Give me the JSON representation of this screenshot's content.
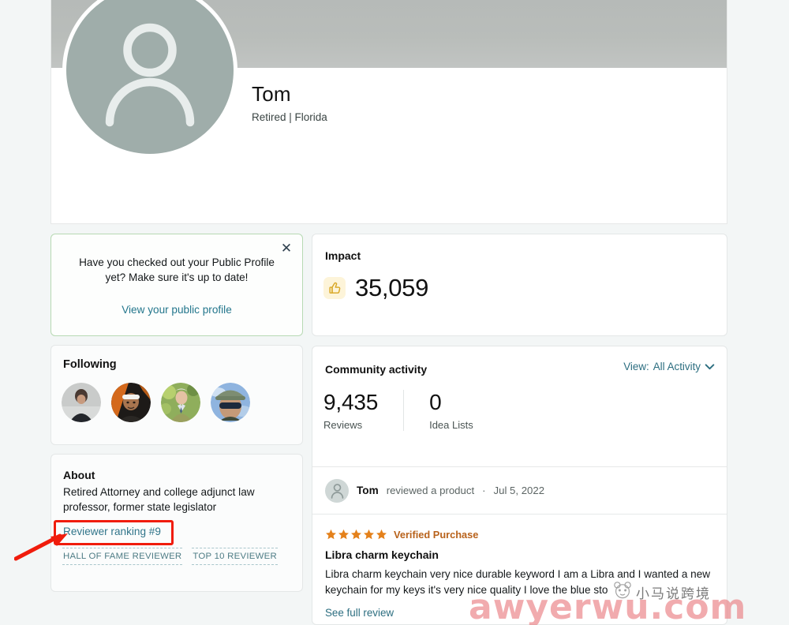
{
  "profile": {
    "name": "Tom",
    "subtitle": "Retired | Florida",
    "avatar_icon": "person-avatar-icon"
  },
  "public_profile_promo": {
    "message": "Have you checked out your Public Profile yet? Make sure it's up to date!",
    "link_label": "View your public profile",
    "close_icon": "close-icon",
    "border_color": "#b7d9b3"
  },
  "following": {
    "title": "Following",
    "avatars": [
      {
        "name": "following-avatar-1",
        "alt": "person in dark suit on gray background"
      },
      {
        "name": "following-avatar-2",
        "alt": "person with white headband on orange background"
      },
      {
        "name": "following-avatar-3",
        "alt": "person in light jacket with green foliage"
      },
      {
        "name": "following-avatar-4",
        "alt": "person with cap and sunglasses on blue background"
      }
    ]
  },
  "about": {
    "title": "About",
    "body": "Retired Attorney and college adjunct law professor, former state legislator",
    "rank_link": "Reviewer ranking #9",
    "badges": [
      "HALL OF FAME REVIEWER",
      "TOP 10 REVIEWER"
    ],
    "link_color": "#31758a"
  },
  "impact": {
    "title": "Impact",
    "value": "35,059",
    "icon": "thumbs-up-icon",
    "icon_bg": "#fdf4d9"
  },
  "community_activity": {
    "title": "Community activity",
    "view_label": "View:",
    "view_value": "All Activity",
    "chevron_icon": "chevron-down-icon",
    "stats": [
      {
        "value": "9,435",
        "label": "Reviews"
      },
      {
        "value": "0",
        "label": "Idea Lists"
      }
    ],
    "activity": {
      "avatar_icon": "person-avatar-icon",
      "user": "Tom",
      "action": "reviewed a product",
      "separator": "·",
      "date": "Jul 5, 2022"
    },
    "review": {
      "stars": 5,
      "star_icon": "star-icon",
      "star_color": "#e4811b",
      "verified_label": "Verified Purchase",
      "title": "Libra charm keychain",
      "body": "Libra charm keychain very nice durable keyword I am a Libra and I wanted a new keychain for my keys it's very nice quality I love the blue sto",
      "see_full_label": "See full review"
    }
  },
  "annotations": {
    "highlight_color": "#f01c0c",
    "highlight_target": "Reviewer ranking #9",
    "arrow_icon": "arrow-pointer-icon"
  },
  "watermarks": {
    "pink_text": "awyerwu.com",
    "chinese_text": "小马说跨境",
    "logo_icon": "panda-logo-icon"
  }
}
